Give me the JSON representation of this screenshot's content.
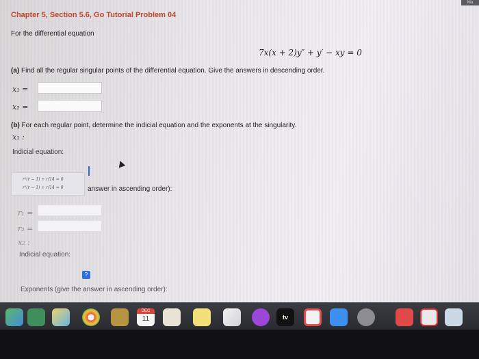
{
  "page": {
    "title": "Chapter 5, Section 5.6, Go Tutorial Problem 04",
    "intro": "For the differential equation",
    "equation": "7x(x + 2)y″ + y′ − xy = 0",
    "corner_badge": "Mo"
  },
  "part_a": {
    "prompt_label": "(a)",
    "prompt": " Find all the regular singular points of the differential equation. Give the answers in descending order.",
    "x1_label": "x₁ =",
    "x2_label": "x₂ ="
  },
  "part_b": {
    "prompt_label": "(b)",
    "prompt": " For each regular point, determine the indicial equation and the exponents at the singularity.",
    "x1_label": "x₁ :",
    "indicial_label": "Indicial equation:",
    "dropdown_options": [
      "r²(r − 1) + r/14 = 0",
      "r²(r − 1) + r/14 = 0"
    ],
    "exponents_tail": "answer in ascending order):",
    "r1_label": "r₁ =",
    "r2_label": "r₂ =",
    "x2_label": "x₂ :",
    "indicial_label_2": "Indicial equation:",
    "exponents_label_2": "Exponents (give the answer in ascending order):"
  },
  "dock": {
    "calendar_month": "DEC",
    "calendar_day": "11",
    "tv_label": "tv",
    "icons": [
      "maps-icon",
      "photos-icon",
      "notes-icon",
      "chrome-icon",
      "stickies-icon",
      "calendar-icon",
      "contacts-icon",
      "notes-yellow-icon",
      "music-icon",
      "podcasts-icon",
      "apple-tv-icon",
      "news-icon",
      "app-store-icon",
      "system-preferences-icon",
      "mail-icon",
      "word-icon",
      "preview-icon"
    ]
  }
}
